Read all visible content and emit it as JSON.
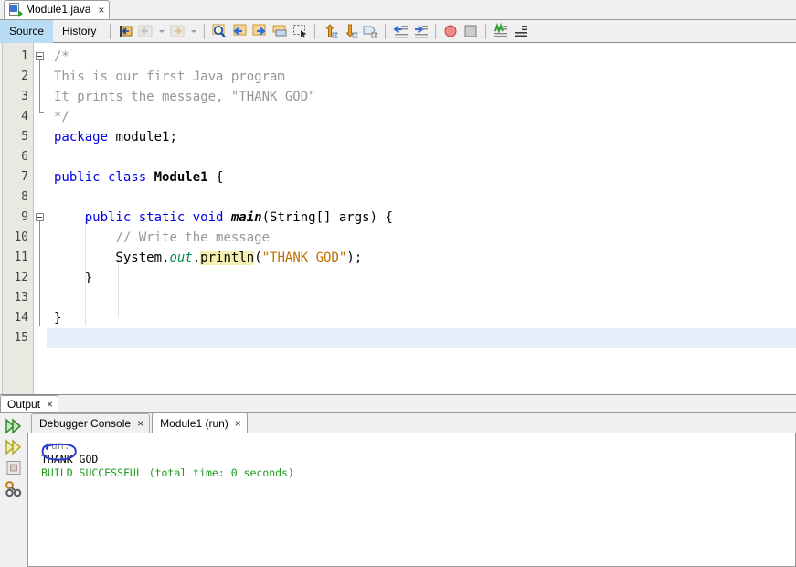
{
  "window": {
    "title": "Module1.java"
  },
  "file_tab": {
    "icon": "java-file-icon",
    "label": "Module1.java",
    "close": "×"
  },
  "view_tabs": [
    {
      "label": "Source",
      "active": true
    },
    {
      "label": "History",
      "active": false
    }
  ],
  "toolbar": {
    "buttons": [
      {
        "name": "last-edit-position",
        "title": "Last Edit"
      },
      {
        "name": "back-navigation",
        "title": "Back"
      },
      {
        "name": "back-dropdown",
        "title": "Back History"
      },
      {
        "name": "forward-navigation",
        "title": "Forward"
      },
      {
        "name": "forward-dropdown",
        "title": "Forward History"
      },
      {
        "name": "find-selection",
        "title": "Find Selection"
      },
      {
        "name": "find-previous",
        "title": "Find Previous"
      },
      {
        "name": "find-next",
        "title": "Find Next"
      },
      {
        "name": "toggle-highlight-search",
        "title": "Toggle Highlight Search"
      },
      {
        "name": "toggle-rectangular-selection",
        "title": "Toggle Rectangular Selection"
      },
      {
        "name": "previous-bookmark",
        "title": "Previous Bookmark"
      },
      {
        "name": "next-bookmark",
        "title": "Next Bookmark"
      },
      {
        "name": "toggle-bookmark",
        "title": "Toggle Bookmark"
      },
      {
        "name": "shift-line-left",
        "title": "Shift Line Left"
      },
      {
        "name": "shift-line-right",
        "title": "Shift Line Right"
      },
      {
        "name": "toggle-breakpoint",
        "title": "Toggle Breakpoint"
      },
      {
        "name": "stop",
        "title": "Stop"
      },
      {
        "name": "inspect-members",
        "title": "Inspect Members"
      },
      {
        "name": "inspect-hierarchy",
        "title": "Inspect Hierarchy"
      }
    ]
  },
  "editor": {
    "line_numbers": [
      "1",
      "2",
      "3",
      "4",
      "5",
      "6",
      "7",
      "8",
      "9",
      "10",
      "11",
      "12",
      "13",
      "14",
      "15"
    ],
    "current_line": 15,
    "lines": [
      {
        "n": 1,
        "tokens": [
          {
            "t": "/*",
            "c": "cm"
          }
        ]
      },
      {
        "n": 2,
        "tokens": [
          {
            "t": "This is our first Java program",
            "c": "cm"
          }
        ]
      },
      {
        "n": 3,
        "tokens": [
          {
            "t": "It prints the message, \"THANK GOD\"",
            "c": "cm"
          }
        ]
      },
      {
        "n": 4,
        "tokens": [
          {
            "t": "*/",
            "c": "cm"
          }
        ]
      },
      {
        "n": 5,
        "tokens": [
          {
            "t": "package ",
            "c": "k"
          },
          {
            "t": "module1;",
            "c": "pl"
          }
        ]
      },
      {
        "n": 6,
        "tokens": []
      },
      {
        "n": 7,
        "tokens": [
          {
            "t": "public class ",
            "c": "k"
          },
          {
            "t": "Module1",
            "c": "cls"
          },
          {
            "t": " {",
            "c": "pl"
          }
        ]
      },
      {
        "n": 8,
        "tokens": []
      },
      {
        "n": 9,
        "tokens": [
          {
            "t": "    ",
            "c": "pl"
          },
          {
            "t": "public static void ",
            "c": "k"
          },
          {
            "t": "main",
            "c": "mth"
          },
          {
            "t": "(String[] args) {",
            "c": "pl"
          }
        ]
      },
      {
        "n": 10,
        "tokens": [
          {
            "t": "        ",
            "c": "pl"
          },
          {
            "t": "// Write the message",
            "c": "cm"
          }
        ]
      },
      {
        "n": 11,
        "tokens": [
          {
            "t": "        System.",
            "c": "pl"
          },
          {
            "t": "out",
            "c": "fld"
          },
          {
            "t": ".",
            "c": "pl"
          },
          {
            "t": "println",
            "c": "hl"
          },
          {
            "t": "(",
            "c": "pl"
          },
          {
            "t": "\"THANK GOD\"",
            "c": "str"
          },
          {
            "t": ");",
            "c": "pl"
          }
        ]
      },
      {
        "n": 12,
        "tokens": [
          {
            "t": "    }",
            "c": "pl"
          }
        ]
      },
      {
        "n": 13,
        "tokens": []
      },
      {
        "n": 14,
        "tokens": [
          {
            "t": "}",
            "c": "pl"
          }
        ]
      },
      {
        "n": 15,
        "tokens": []
      }
    ]
  },
  "output": {
    "panel_tab": {
      "label": "Output",
      "close": "×"
    },
    "inner_tabs": [
      {
        "label": "Debugger Console",
        "close": "×",
        "active": false
      },
      {
        "label": "Module1 (run)",
        "close": "×",
        "active": true
      }
    ],
    "sidebar_icons": [
      {
        "name": "rerun-icon"
      },
      {
        "name": "rerun-with-different-params-icon"
      },
      {
        "name": "stop-process-icon"
      },
      {
        "name": "settings-wrench-icon"
      }
    ],
    "console_lines": [
      {
        "text": "run:",
        "kind": "run"
      },
      {
        "text": "THANK GOD",
        "kind": "out"
      },
      {
        "text": "BUILD SUCCESSFUL (total time: 0 seconds)",
        "kind": "ok"
      }
    ],
    "annotation": {
      "name": "hand-drawn-ellipse",
      "color": "#2a3fd0",
      "target": "run:"
    }
  },
  "colors": {
    "keyword": "#0000e6",
    "comment": "#969696",
    "string": "#c07000",
    "field": "#0a8a4a",
    "highlight": "#f5f0b0",
    "current_line": "#e6eefa",
    "build_success": "#1d9a1d",
    "active_tab": "#b9dcf4"
  }
}
